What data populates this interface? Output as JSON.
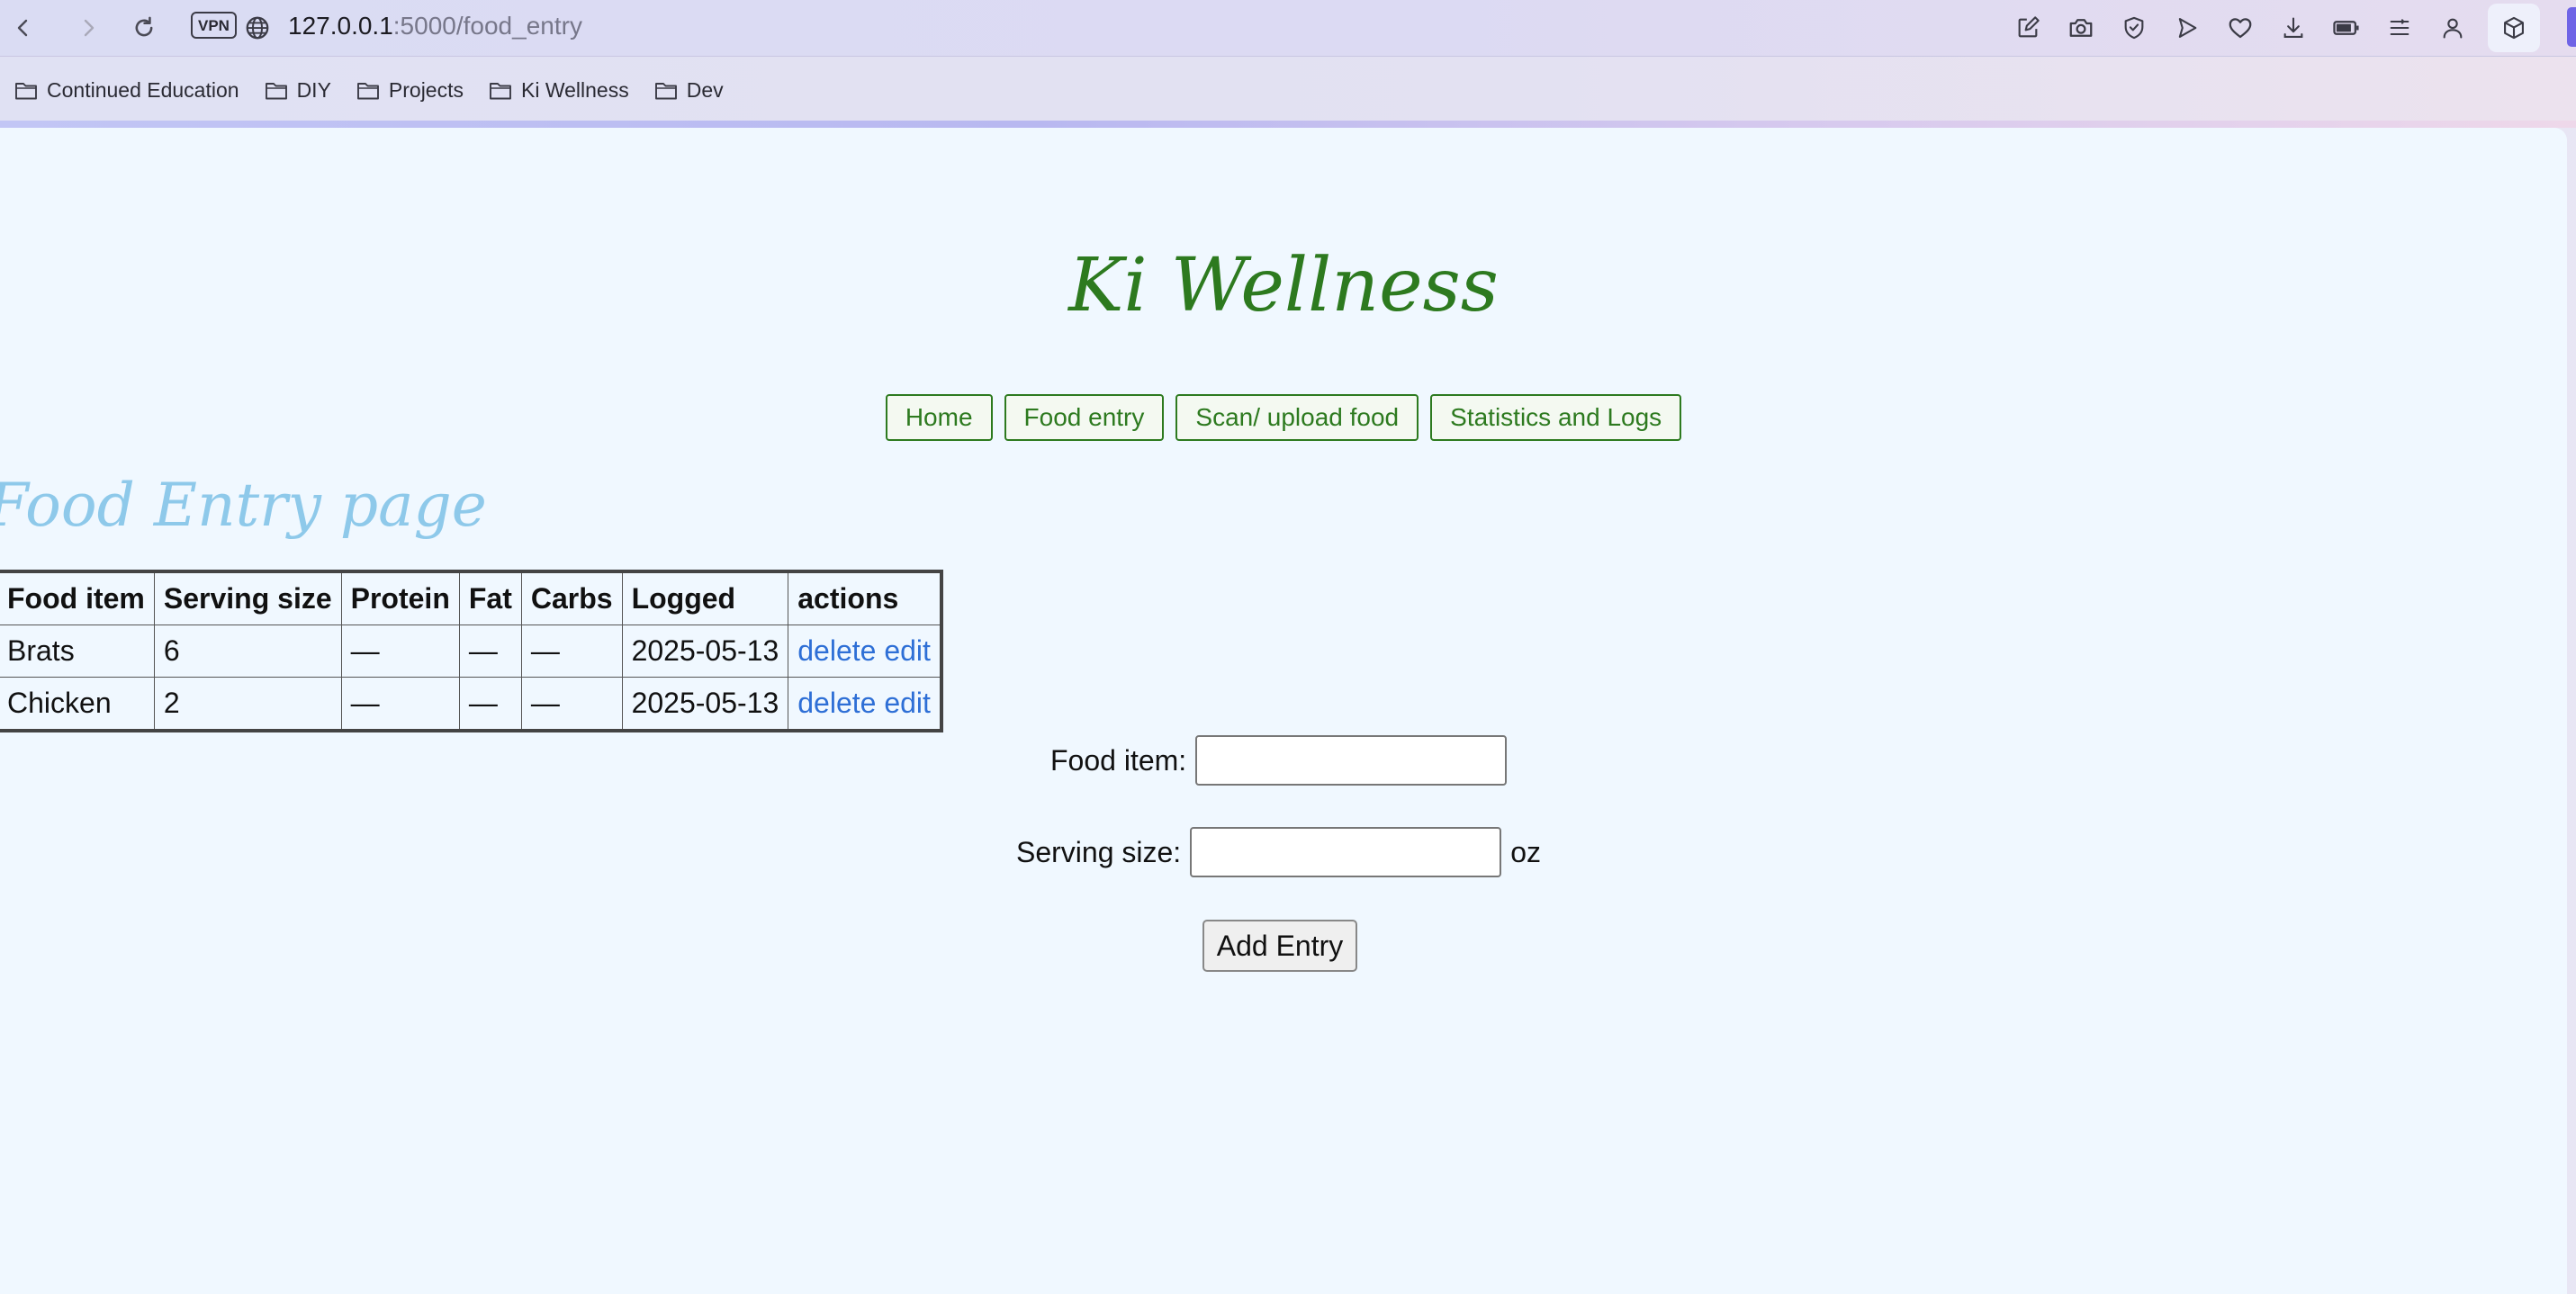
{
  "browser": {
    "url_host": "127.0.0.1",
    "url_rest": ":5000/food_entry",
    "vpn_label": "VPN",
    "bookmarks": [
      {
        "label": "Continued Education"
      },
      {
        "label": "DIY"
      },
      {
        "label": "Projects"
      },
      {
        "label": "Ki Wellness"
      },
      {
        "label": "Dev"
      }
    ],
    "accent_color": "#6f64e6"
  },
  "page": {
    "site_title": "Ki Wellness",
    "nav": [
      {
        "label": "Home"
      },
      {
        "label": "Food entry"
      },
      {
        "label": "Scan/ upload food"
      },
      {
        "label": "Statistics and Logs"
      }
    ],
    "heading": "Food Entry page",
    "table": {
      "headers": [
        "Food item",
        "Serving size",
        "Protein",
        "Fat",
        "Carbs",
        "Logged",
        "actions"
      ],
      "rows": [
        {
          "food": "Brats",
          "serving": "6",
          "protein": "—",
          "fat": "—",
          "carbs": "—",
          "logged": "2025-05-13",
          "delete": "delete",
          "edit": "edit"
        },
        {
          "food": "Chicken",
          "serving": "2",
          "protein": "—",
          "fat": "—",
          "carbs": "—",
          "logged": "2025-05-13",
          "delete": "delete",
          "edit": "edit"
        }
      ]
    },
    "form": {
      "food_item_label": "Food item:",
      "food_item_value": "",
      "serving_size_label": "Serving size:",
      "serving_size_value": "",
      "serving_unit": "oz",
      "submit_label": "Add Entry"
    },
    "colors": {
      "brand_green": "#2d7a1f",
      "heading_blue": "#8ec9ea",
      "link_blue": "#2e6fd6",
      "background": "#f0f8ff"
    }
  }
}
